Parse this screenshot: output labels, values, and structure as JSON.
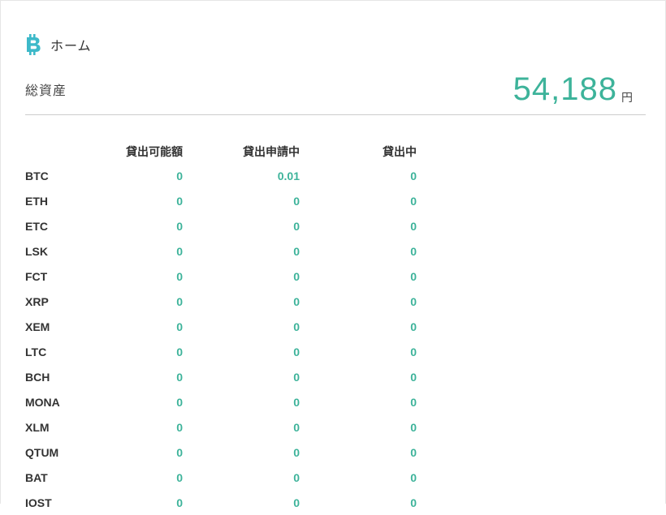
{
  "header": {
    "title": "ホーム",
    "logo_icon": "bitcoin-icon",
    "accent_color": "#3db9c9"
  },
  "assets": {
    "label": "総資産",
    "value": "54,188",
    "unit": "円",
    "value_color": "#3db39a"
  },
  "table": {
    "columns": [
      "",
      "貸出可能額",
      "貸出申請中",
      "貸出中"
    ],
    "rows": [
      {
        "symbol": "BTC",
        "available": "0",
        "requesting": "0.01",
        "lending": "0"
      },
      {
        "symbol": "ETH",
        "available": "0",
        "requesting": "0",
        "lending": "0"
      },
      {
        "symbol": "ETC",
        "available": "0",
        "requesting": "0",
        "lending": "0"
      },
      {
        "symbol": "LSK",
        "available": "0",
        "requesting": "0",
        "lending": "0"
      },
      {
        "symbol": "FCT",
        "available": "0",
        "requesting": "0",
        "lending": "0"
      },
      {
        "symbol": "XRP",
        "available": "0",
        "requesting": "0",
        "lending": "0"
      },
      {
        "symbol": "XEM",
        "available": "0",
        "requesting": "0",
        "lending": "0"
      },
      {
        "symbol": "LTC",
        "available": "0",
        "requesting": "0",
        "lending": "0"
      },
      {
        "symbol": "BCH",
        "available": "0",
        "requesting": "0",
        "lending": "0"
      },
      {
        "symbol": "MONA",
        "available": "0",
        "requesting": "0",
        "lending": "0"
      },
      {
        "symbol": "XLM",
        "available": "0",
        "requesting": "0",
        "lending": "0"
      },
      {
        "symbol": "QTUM",
        "available": "0",
        "requesting": "0",
        "lending": "0"
      },
      {
        "symbol": "BAT",
        "available": "0",
        "requesting": "0",
        "lending": "0"
      },
      {
        "symbol": "IOST",
        "available": "0",
        "requesting": "0",
        "lending": "0"
      }
    ]
  }
}
